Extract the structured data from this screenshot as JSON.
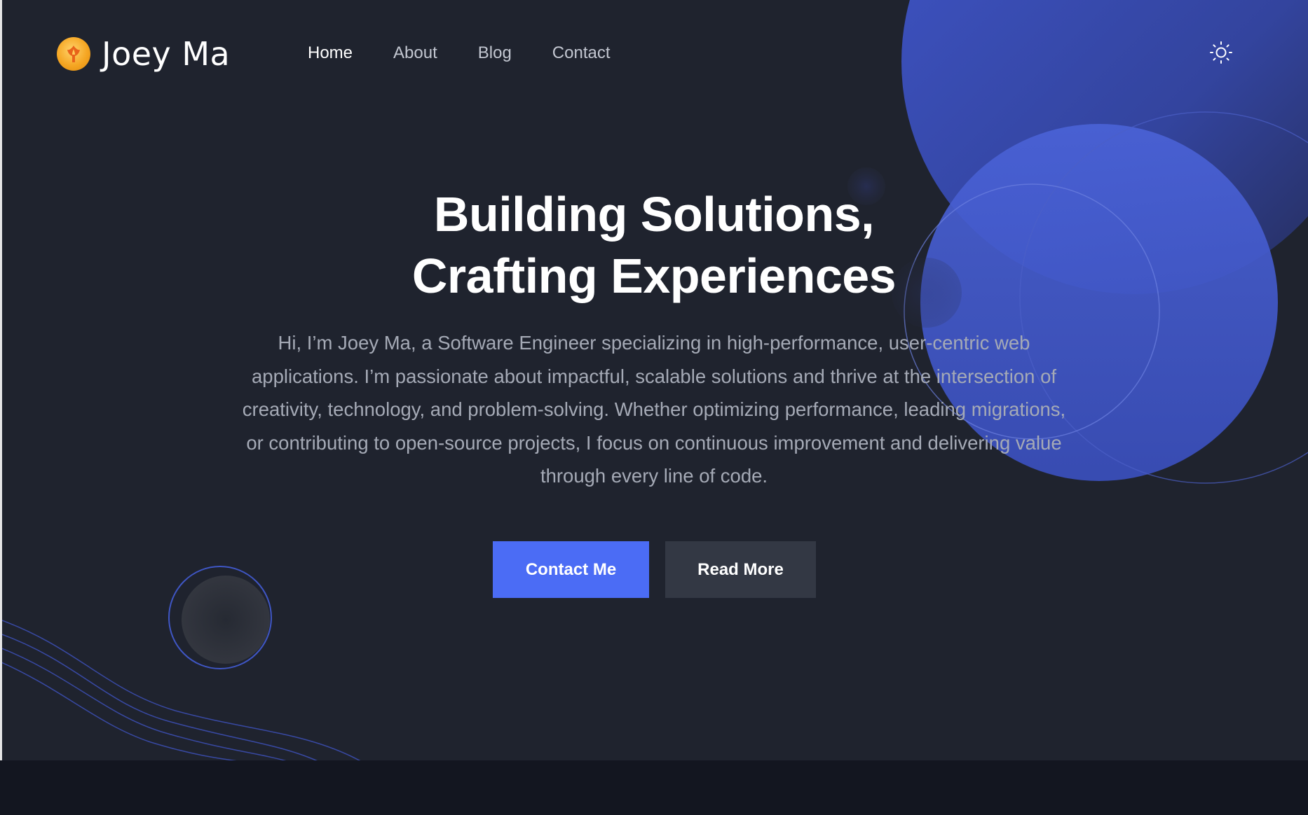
{
  "header": {
    "brand_name": "Joey Ma",
    "nav": [
      {
        "label": "Home",
        "active": true
      },
      {
        "label": "About",
        "active": false
      },
      {
        "label": "Blog",
        "active": false
      },
      {
        "label": "Contact",
        "active": false
      }
    ],
    "theme_toggle_icon": "sun-icon"
  },
  "hero": {
    "title_line1": "Building Solutions,",
    "title_line2": "Crafting Experiences",
    "description": "Hi, I’m Joey Ma, a Software Engineer specializing in high-performance, user-centric web applications. I’m passionate about impactful, scalable solutions and thrive at the intersection of creativity, technology, and problem-solving. Whether optimizing performance, leading migrations, or contributing to open-source projects, I focus on continuous improvement and delivering value through every line of code.",
    "primary_button": "Contact Me",
    "secondary_button": "Read More"
  },
  "colors": {
    "background": "#1f232e",
    "accent": "#4b6cf5",
    "secondary_button": "#333844",
    "footer_band": "#131620"
  }
}
